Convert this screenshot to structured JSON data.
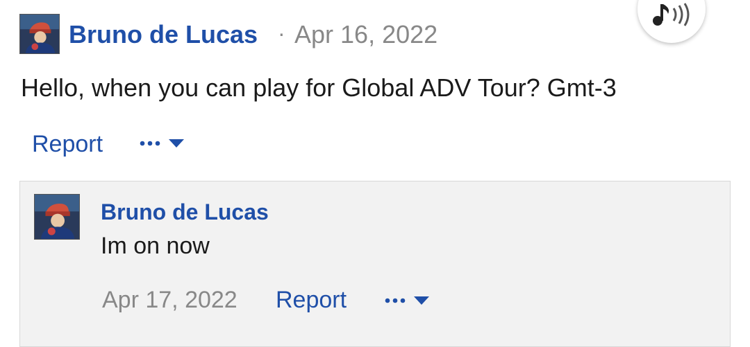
{
  "comment": {
    "author": "Bruno de Lucas",
    "separator": "·",
    "date": "Apr 16, 2022",
    "text": "Hello, when you can play for Global ADV Tour? Gmt-3",
    "report_label": "Report",
    "more_icon": "more-dropdown-icon"
  },
  "reply": {
    "author": "Bruno de Lucas",
    "text": "Im on now",
    "date": "Apr 17, 2022",
    "report_label": "Report",
    "more_icon": "more-dropdown-icon"
  },
  "audio_button": {
    "icon": "audio-speaker-icon"
  },
  "colors": {
    "link": "#1f4fa8",
    "muted": "#888888",
    "text": "#1a1a1a",
    "reply_bg": "#f2f2f2"
  }
}
